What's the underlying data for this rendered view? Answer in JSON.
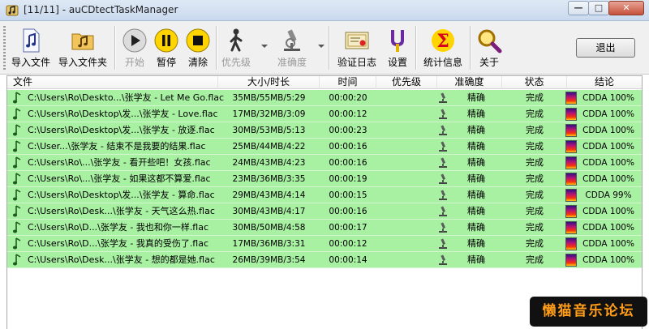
{
  "window": {
    "title": "[11/11] - auCDtectTaskManager",
    "controls": {
      "minimize": "—",
      "maximize": "□",
      "close": "✕"
    }
  },
  "toolbar": {
    "buttons": [
      {
        "label": "导入文件",
        "icon": "music-note-file-icon",
        "enabled": true
      },
      {
        "label": "导入文件夹",
        "icon": "music-folder-icon",
        "enabled": true
      },
      {
        "label": "开始",
        "icon": "play-icon",
        "enabled": false
      },
      {
        "label": "暂停",
        "icon": "pause-icon",
        "enabled": true
      },
      {
        "label": "清除",
        "icon": "stop-icon",
        "enabled": true
      },
      {
        "label": "优先级",
        "icon": "person-walking-icon",
        "enabled": false
      },
      {
        "label": "准确度",
        "icon": "microscope-icon",
        "enabled": false
      },
      {
        "label": "验证日志",
        "icon": "certificate-icon",
        "enabled": true
      },
      {
        "label": "设置",
        "icon": "tuning-fork-icon",
        "enabled": true
      },
      {
        "label": "统计信息",
        "icon": "sigma-icon",
        "enabled": true
      },
      {
        "label": "关于",
        "icon": "magnifier-icon",
        "enabled": true
      }
    ],
    "exit_label": "退出"
  },
  "list": {
    "columns": [
      "文件",
      "大小/时长",
      "时间",
      "优先级",
      "准确度",
      "状态",
      "结论"
    ],
    "row_color": "#a8f0a2",
    "rows": [
      {
        "file": "C:\\Users\\Ro\\Deskto...\\张学友 - Let Me Go.flac",
        "size": "35MB/55MB/5:29",
        "time": "00:00:20",
        "priority": "",
        "accuracy": "精确",
        "status": "完成",
        "result": "CDDA 100%"
      },
      {
        "file": "C:\\Users\\Ro\\Desktop\\发...\\张学友 - Love.flac",
        "size": "17MB/32MB/3:09",
        "time": "00:00:12",
        "priority": "",
        "accuracy": "精确",
        "status": "完成",
        "result": "CDDA 100%"
      },
      {
        "file": "C:\\Users\\Ro\\Desktop\\发...\\张学友 - 放逐.flac",
        "size": "30MB/53MB/5:13",
        "time": "00:00:23",
        "priority": "",
        "accuracy": "精确",
        "status": "完成",
        "result": "CDDA 100%"
      },
      {
        "file": "C:\\User...\\张学友 - 结束不是我要的结果.flac",
        "size": "25MB/44MB/4:22",
        "time": "00:00:16",
        "priority": "",
        "accuracy": "精确",
        "status": "完成",
        "result": "CDDA 100%"
      },
      {
        "file": "C:\\Users\\Ro\\...\\张学友 - 看开些吧！女孩.flac",
        "size": "24MB/43MB/4:23",
        "time": "00:00:16",
        "priority": "",
        "accuracy": "精确",
        "status": "完成",
        "result": "CDDA 100%"
      },
      {
        "file": "C:\\Users\\Ro\\...\\张学友 - 如果这都不算爱.flac",
        "size": "23MB/36MB/3:35",
        "time": "00:00:19",
        "priority": "",
        "accuracy": "精确",
        "status": "完成",
        "result": "CDDA 100%"
      },
      {
        "file": "C:\\Users\\Ro\\Desktop\\发...\\张学友 - 算命.flac",
        "size": "29MB/43MB/4:14",
        "time": "00:00:15",
        "priority": "",
        "accuracy": "精确",
        "status": "完成",
        "result": "CDDA 99%"
      },
      {
        "file": "C:\\Users\\Ro\\Desk...\\张学友 - 天气这么热.flac",
        "size": "30MB/43MB/4:17",
        "time": "00:00:16",
        "priority": "",
        "accuracy": "精确",
        "status": "完成",
        "result": "CDDA 100%"
      },
      {
        "file": "C:\\Users\\Ro\\D...\\张学友 - 我也和你一样.flac",
        "size": "30MB/50MB/4:58",
        "time": "00:00:17",
        "priority": "",
        "accuracy": "精确",
        "status": "完成",
        "result": "CDDA 100%"
      },
      {
        "file": "C:\\Users\\Ro\\D...\\张学友 - 我真的受伤了.flac",
        "size": "17MB/36MB/3:31",
        "time": "00:00:12",
        "priority": "",
        "accuracy": "精确",
        "status": "完成",
        "result": "CDDA 100%"
      },
      {
        "file": "C:\\Users\\Ro\\Desk...\\张学友 - 想的都是她.flac",
        "size": "26MB/39MB/3:54",
        "time": "00:00:14",
        "priority": "",
        "accuracy": "精确",
        "status": "完成",
        "result": "CDDA 100%"
      }
    ]
  },
  "watermark": "懒猫音乐论坛"
}
